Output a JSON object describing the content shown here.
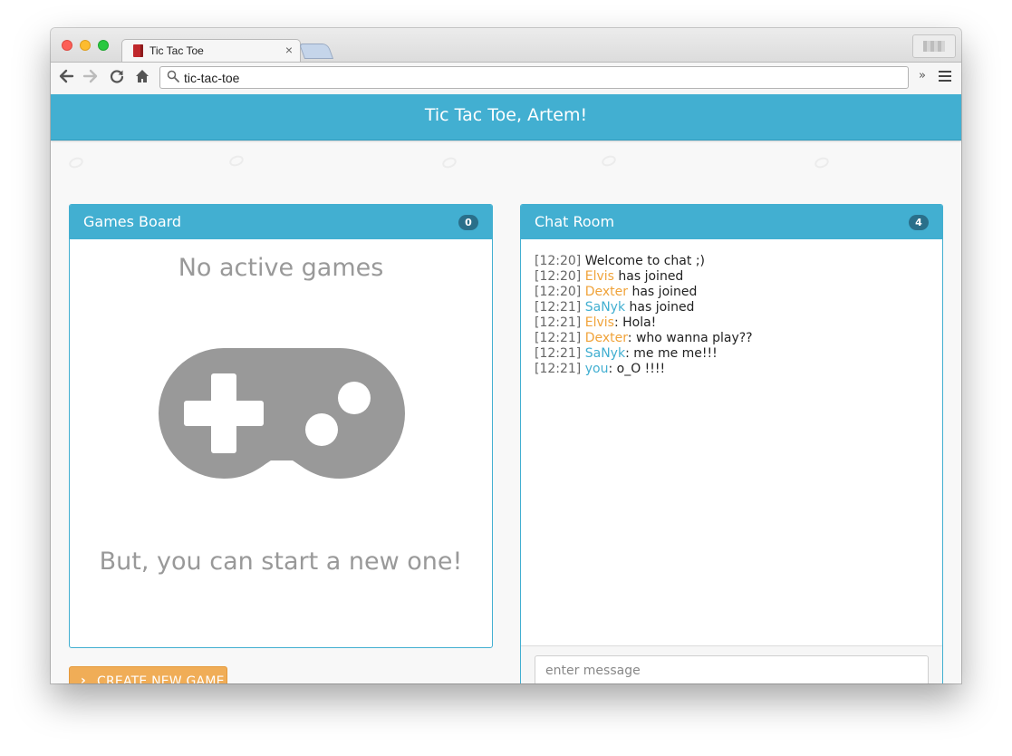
{
  "browser": {
    "tab_title": "Tic Tac Toe",
    "tab_close": "×",
    "url": "tic-tac-toe",
    "extensions_chevron": "»"
  },
  "navbar": {
    "title": "Tic Tac Toe, Artem!"
  },
  "games_board": {
    "title": "Games Board",
    "count": "0",
    "empty_title": "No active games",
    "empty_subtitle": "But, you can start a new one!",
    "gamepad_color": "#999999"
  },
  "create_button": {
    "label": "CREATE NEW GAME"
  },
  "chat": {
    "title": "Chat Room",
    "count": "4",
    "input_placeholder": "enter message",
    "messages": [
      {
        "time": "[12:20]",
        "name": "",
        "text": "Welcome to chat ;)"
      },
      {
        "time": "[12:20]",
        "name": "Elvis",
        "text": "has joined"
      },
      {
        "time": "[12:20]",
        "name": "Dexter",
        "text": "has joined"
      },
      {
        "time": "[12:21]",
        "name": "SaNyk",
        "text": "has joined"
      },
      {
        "time": "[12:21]",
        "name": "Elvis",
        "text": ": Hola!"
      },
      {
        "time": "[12:21]",
        "name": "Dexter",
        "text": ": who wanna play??"
      },
      {
        "time": "[12:21]",
        "name": "SaNyk",
        "text": ": me me me!!!"
      },
      {
        "time": "[12:21]",
        "name": "you",
        "text": ": o_O !!!!"
      }
    ]
  },
  "colors": {
    "primary": "#42afd1",
    "accent_orange": "#f0ad57",
    "name_orange": "#f0a33a",
    "badge": "#2a6f8a"
  }
}
